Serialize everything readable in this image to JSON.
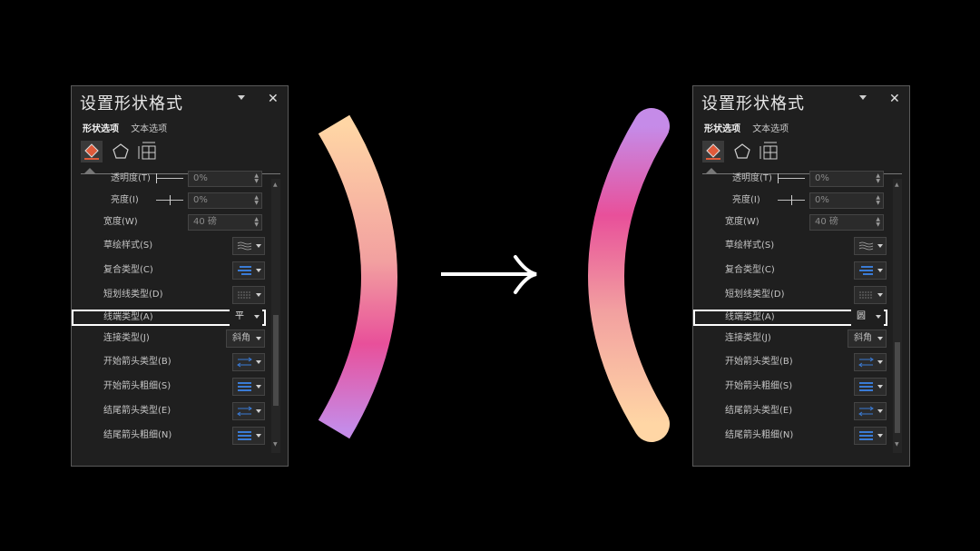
{
  "panels": [
    {
      "title": "设置形状格式",
      "close": "✕",
      "tabs": [
        "形状选项",
        "文本选项"
      ],
      "rows": {
        "transparency": {
          "label": "透明度(T)",
          "value": "0%"
        },
        "brightness": {
          "label": "亮度(I)",
          "value": "0%"
        },
        "width": {
          "label": "宽度(W)",
          "value": "40 磅"
        },
        "sketch": {
          "label": "草绘样式(S)"
        },
        "compound": {
          "label": "复合类型(C)"
        },
        "dash": {
          "label": "短划线类型(D)"
        },
        "cap": {
          "label": "线端类型(A)",
          "value": "平"
        },
        "join": {
          "label": "连接类型(J)",
          "value": "斜角"
        },
        "begin_arrow_type": {
          "label": "开始箭头类型(B)"
        },
        "begin_arrow_size": {
          "label": "开始箭头粗细(S)"
        },
        "end_arrow_type": {
          "label": "结尾箭头类型(E)"
        },
        "end_arrow_size": {
          "label": "结尾箭头粗细(N)"
        }
      }
    },
    {
      "title": "设置形状格式",
      "close": "✕",
      "tabs": [
        "形状选项",
        "文本选项"
      ],
      "rows": {
        "transparency": {
          "label": "透明度(T)",
          "value": "0%"
        },
        "brightness": {
          "label": "亮度(I)",
          "value": "0%"
        },
        "width": {
          "label": "宽度(W)",
          "value": "40 磅"
        },
        "sketch": {
          "label": "草绘样式(S)"
        },
        "compound": {
          "label": "复合类型(C)"
        },
        "dash": {
          "label": "短划线类型(D)"
        },
        "cap": {
          "label": "线端类型(A)",
          "value": "圆"
        },
        "join": {
          "label": "连接类型(J)",
          "value": "斜角"
        },
        "begin_arrow_type": {
          "label": "开始箭头类型(B)"
        },
        "begin_arrow_size": {
          "label": "开始箭头粗细(S)"
        },
        "end_arrow_type": {
          "label": "结尾箭头类型(E)"
        },
        "end_arrow_size": {
          "label": "结尾箭头粗细(N)"
        }
      }
    }
  ],
  "colors": {
    "background": "#000000",
    "panel_bg": "#1f1f1f",
    "arc_gradient": [
      "#ffd6a5",
      "#f5a0a0",
      "#e8509a",
      "#c58be8"
    ],
    "icon_blue": "#3a7bd5",
    "highlight": "#ffffff"
  },
  "icons": [
    "fill-line-icon",
    "shape-effects-icon",
    "size-properties-icon",
    "arrow-right-icon"
  ]
}
